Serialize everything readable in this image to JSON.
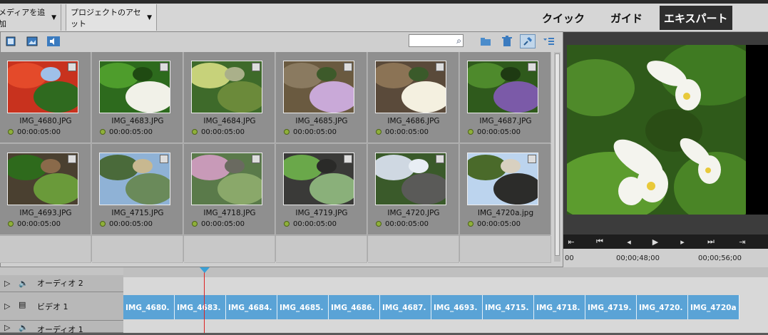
{
  "topbar": {
    "add_media": "メディアを追加",
    "project_assets": "プロジェクトのアセット",
    "modes": [
      "クイック",
      "ガイド",
      "エキスパート"
    ],
    "active_mode": "エキスパート"
  },
  "assets": {
    "search_placeholder": "",
    "items": [
      {
        "name": "IMG_4680.JPG",
        "duration": "00:00:05:00"
      },
      {
        "name": "IMG_4683.JPG",
        "duration": "00:00:05:00"
      },
      {
        "name": "IMG_4684.JPG",
        "duration": "00:00:05:00"
      },
      {
        "name": "IMG_4685.JPG",
        "duration": "00:00:05:00"
      },
      {
        "name": "IMG_4686.JPG",
        "duration": "00:00:05:00"
      },
      {
        "name": "IMG_4687.JPG",
        "duration": "00:00:05:00"
      },
      {
        "name": "IMG_4693.JPG",
        "duration": "00:00:05:00"
      },
      {
        "name": "IMG_4715.JPG",
        "duration": "00:00:05:00"
      },
      {
        "name": "IMG_4718.JPG",
        "duration": "00:00:05:00"
      },
      {
        "name": "IMG_4719.JPG",
        "duration": "00:00:05:00"
      },
      {
        "name": "IMG_4720.JPG",
        "duration": "00:00:05:00"
      },
      {
        "name": "IMG_4720a.jpg",
        "duration": "00:00:05:00"
      }
    ]
  },
  "monitor": {
    "ruler": [
      "00",
      "00;00;48;00",
      "00;00;56;00"
    ]
  },
  "timeline": {
    "tracks": [
      "オーディオ 2",
      "ビデオ 1",
      "オーディオ 1"
    ],
    "clips": [
      "IMG_4680.",
      "IMG_4683.",
      "IMG_4684.",
      "IMG_4685.",
      "IMG_4686.",
      "IMG_4687.",
      "IMG_4693.",
      "IMG_4715.",
      "IMG_4718.",
      "IMG_4719.",
      "IMG_4720.",
      "IMG_4720a"
    ]
  },
  "colors": {
    "clip": "#5aa3d6",
    "playhead": "#dd2222",
    "status_dot": "#8fb03a"
  }
}
